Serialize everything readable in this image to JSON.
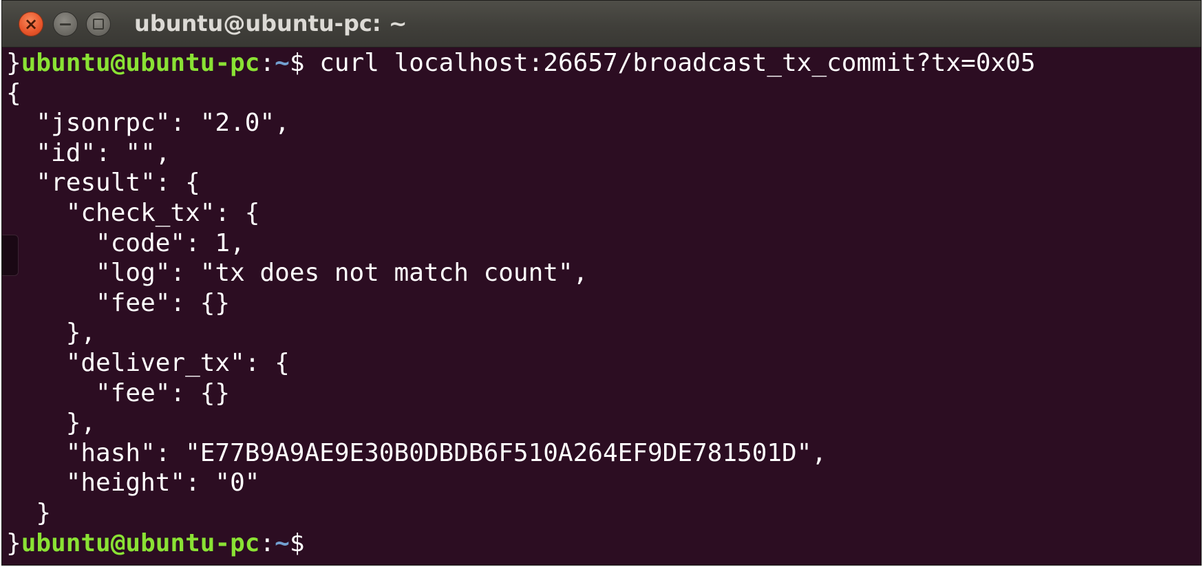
{
  "window": {
    "title": "ubuntu@ubuntu-pc: ~",
    "close_label": "×"
  },
  "prompt": {
    "lead": "}",
    "user_host": "ubuntu@ubuntu-pc",
    "colon": ":",
    "path": "~",
    "symbol": "$"
  },
  "command": " curl localhost:26657/broadcast_tx_commit?tx=0x05",
  "output": [
    "{",
    "  \"jsonrpc\": \"2.0\",",
    "  \"id\": \"\",",
    "  \"result\": {",
    "    \"check_tx\": {",
    "      \"code\": 1,",
    "      \"log\": \"tx does not match count\",",
    "      \"fee\": {}",
    "    },",
    "    \"deliver_tx\": {",
    "      \"fee\": {}",
    "    },",
    "    \"hash\": \"E77B9A9AE9E30B0DBDB6F510A264EF9DE781501D\",",
    "    \"height\": \"0\"",
    "  }"
  ],
  "colors": {
    "background": "#2c0d22",
    "prompt_user": "#8ae234",
    "prompt_path": "#729fcf",
    "text": "#ffffff"
  }
}
